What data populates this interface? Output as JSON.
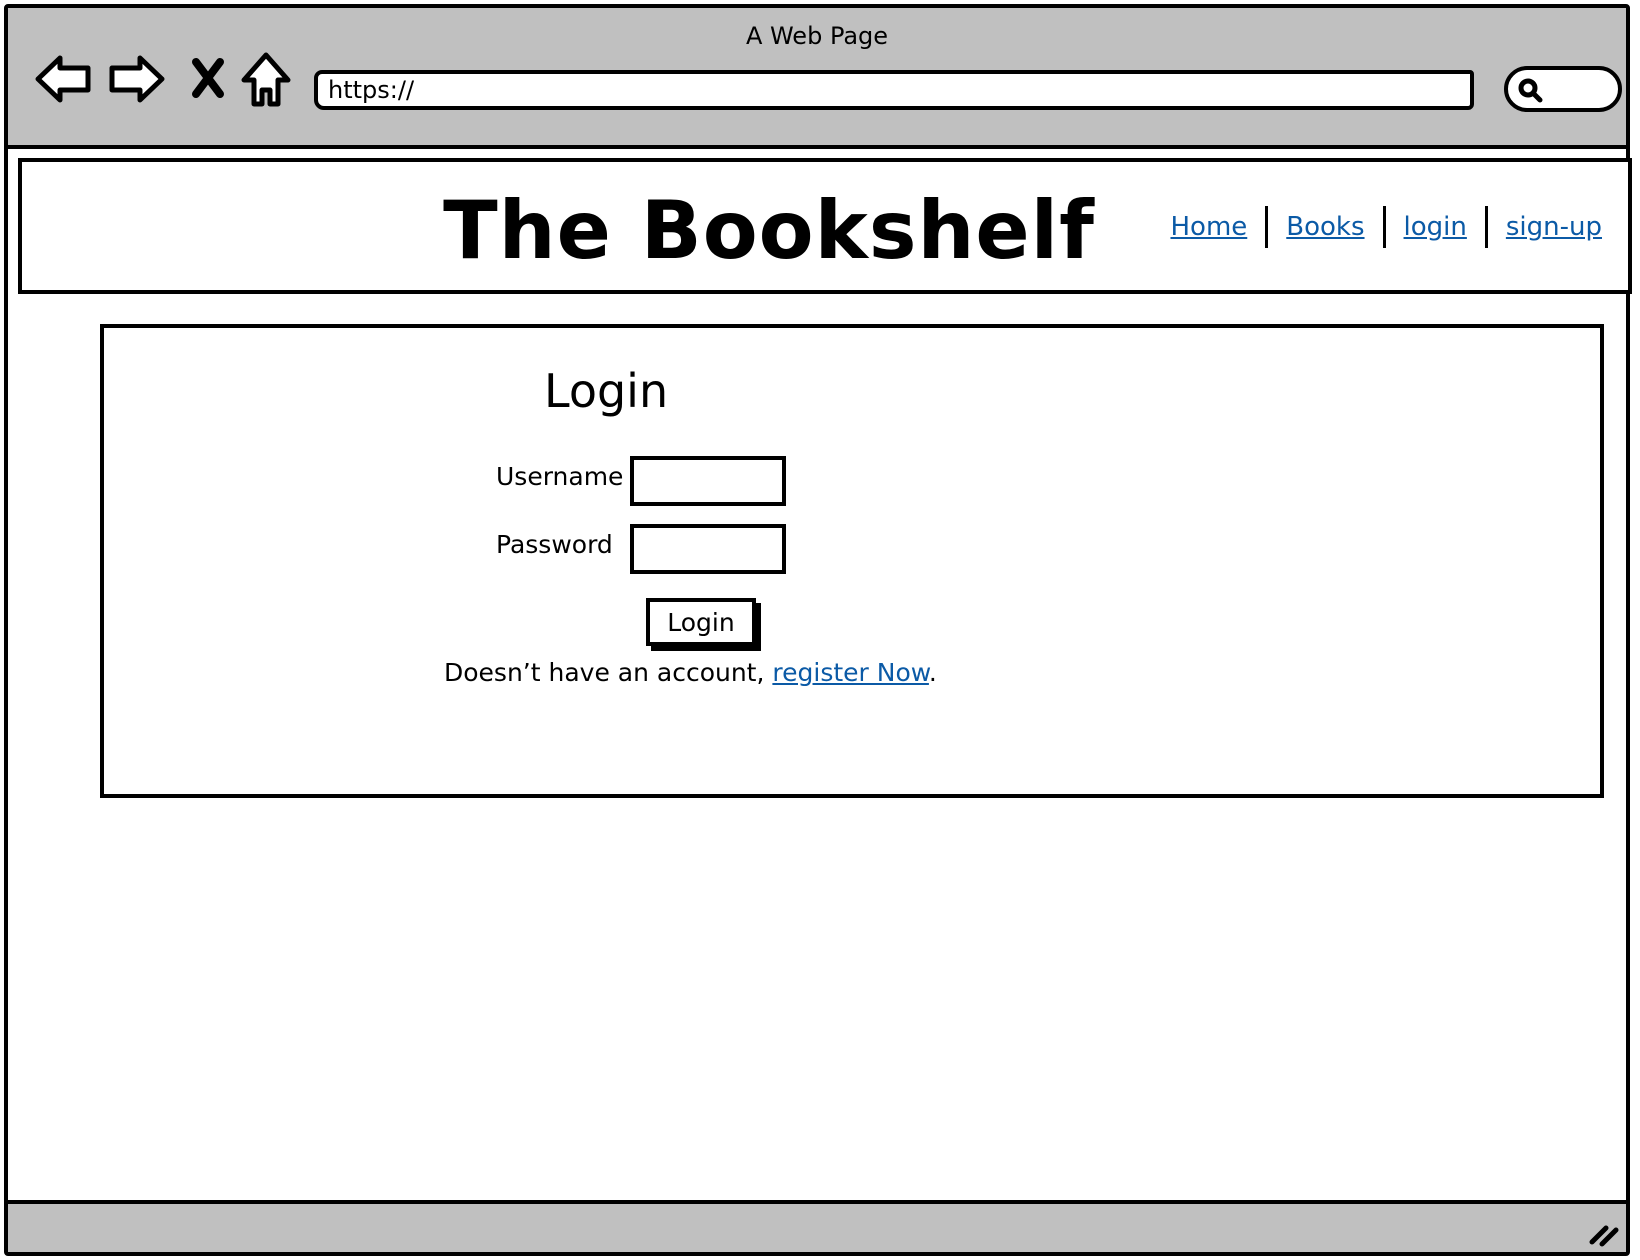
{
  "browser": {
    "title": "A Web Page",
    "url": "https://",
    "icons": [
      "back-arrow-icon",
      "forward-arrow-icon",
      "close-x-icon",
      "home-icon",
      "search-icon",
      "resize-grip-icon"
    ]
  },
  "header": {
    "site_title": "The Bookshelf",
    "nav": [
      {
        "label": "Home"
      },
      {
        "label": "Books"
      },
      {
        "label": "login"
      },
      {
        "label": "sign-up"
      }
    ]
  },
  "login": {
    "heading": "Login",
    "username_label": "Username",
    "username_value": "",
    "password_label": "Password",
    "password_value": "",
    "button_label": "Login",
    "register_prefix": "Doesn’t have an account, ",
    "register_link": "register Now",
    "register_suffix": "."
  },
  "colors": {
    "link": "#0b5aa6",
    "chrome": "#c0c0c0"
  }
}
